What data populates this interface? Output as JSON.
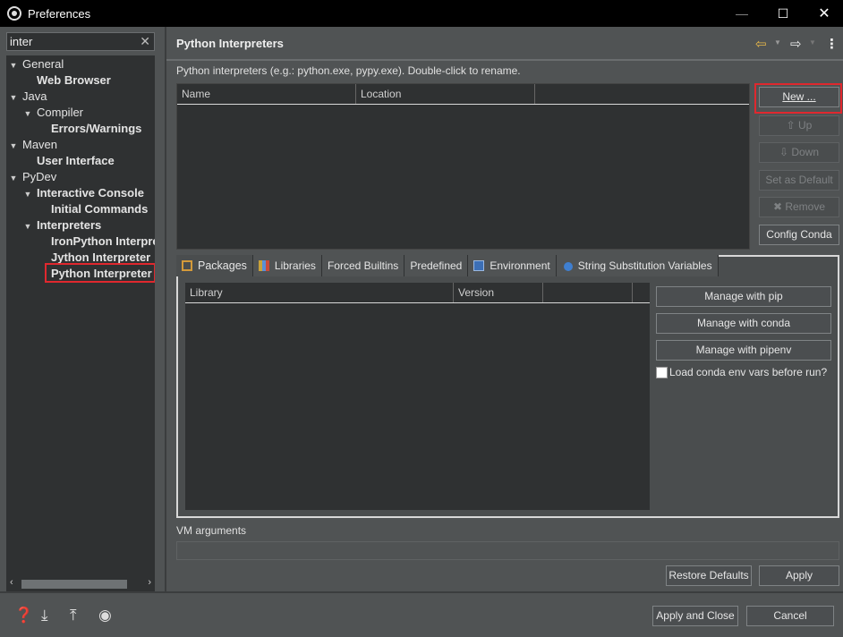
{
  "window": {
    "title": "Preferences"
  },
  "filter": {
    "value": "inter"
  },
  "tree": [
    {
      "label": "General",
      "bold": false,
      "level": 0,
      "twisty": "▼"
    },
    {
      "label": "Web Browser",
      "bold": true,
      "level": 1,
      "twisty": ""
    },
    {
      "label": "Java",
      "bold": false,
      "level": 0,
      "twisty": "▼"
    },
    {
      "label": "Compiler",
      "bold": false,
      "level": 1,
      "twisty": "▼"
    },
    {
      "label": "Errors/Warnings",
      "bold": true,
      "level": 2,
      "twisty": ""
    },
    {
      "label": "Maven",
      "bold": false,
      "level": 0,
      "twisty": "▼"
    },
    {
      "label": "User Interface",
      "bold": true,
      "level": 1,
      "twisty": ""
    },
    {
      "label": "PyDev",
      "bold": false,
      "level": 0,
      "twisty": "▼"
    },
    {
      "label": "Interactive Console",
      "bold": true,
      "level": 1,
      "twisty": "▼"
    },
    {
      "label": "Initial Commands",
      "bold": true,
      "level": 2,
      "twisty": ""
    },
    {
      "label": "Interpreters",
      "bold": true,
      "level": 1,
      "twisty": "▼"
    },
    {
      "label": "IronPython Interpreter",
      "bold": true,
      "level": 2,
      "twisty": ""
    },
    {
      "label": "Jython Interpreter",
      "bold": true,
      "level": 2,
      "twisty": ""
    },
    {
      "label": "Python Interpreter",
      "bold": true,
      "level": 2,
      "twisty": "",
      "selected": true
    }
  ],
  "page": {
    "title": "Python Interpreters",
    "description": "Python interpreters (e.g.: python.exe, pypy.exe).   Double-click to rename."
  },
  "interpreters_table": {
    "columns": [
      "Name",
      "Location",
      ""
    ]
  },
  "side_buttons": {
    "new": "New ...",
    "up": "Up",
    "down": "Down",
    "set_default": "Set as Default",
    "remove": "Remove",
    "config_conda": "Config Conda"
  },
  "tabs": [
    "Packages",
    "Libraries",
    "Forced Builtins",
    "Predefined",
    "Environment",
    "String Substitution Variables"
  ],
  "packages_table": {
    "columns": [
      "Library",
      "Version",
      ""
    ]
  },
  "package_buttons": {
    "pip": "Manage with pip",
    "conda": "Manage with conda",
    "pipenv": "Manage with pipenv"
  },
  "load_conda_label": "Load conda env vars before run?",
  "vm_arguments_label": "VM arguments",
  "buttons": {
    "restore_defaults": "Restore Defaults",
    "apply": "Apply",
    "apply_and_close": "Apply and Close",
    "cancel": "Cancel"
  },
  "colors": {
    "highlight": "#e0282e",
    "background": "#505354",
    "field": "#2f3132"
  }
}
